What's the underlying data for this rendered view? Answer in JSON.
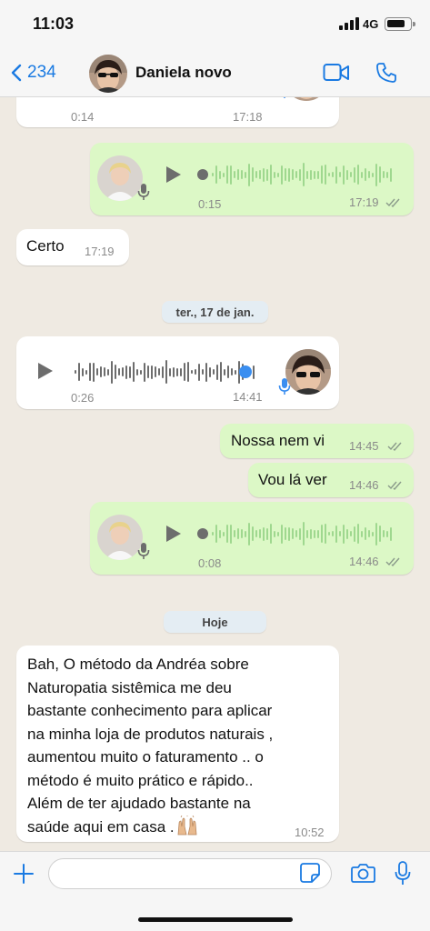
{
  "status_bar": {
    "time": "11:03",
    "network": "4G",
    "battery_level": 0.8
  },
  "header": {
    "back_count": "234",
    "contact_name": "Daniela novo",
    "icons": [
      "back-chevron-icon",
      "video-call-icon",
      "voice-call-icon"
    ]
  },
  "messages": [
    {
      "type": "voice",
      "direction": "incoming",
      "duration": "0:14",
      "time": "17:18",
      "partial": true
    },
    {
      "type": "voice",
      "direction": "outgoing",
      "duration": "0:15",
      "time": "17:19",
      "progress": 0.0
    },
    {
      "type": "text",
      "direction": "incoming",
      "text": "Certo",
      "time": "17:19"
    },
    {
      "type": "date",
      "label": "ter., 17 de jan."
    },
    {
      "type": "voice",
      "direction": "incoming",
      "duration": "0:26",
      "time": "14:41",
      "progress": 0.9
    },
    {
      "type": "text",
      "direction": "outgoing",
      "text": "Nossa nem vi",
      "time": "14:45"
    },
    {
      "type": "text",
      "direction": "outgoing",
      "text": "Vou lá ver",
      "time": "14:46"
    },
    {
      "type": "voice",
      "direction": "outgoing",
      "duration": "0:08",
      "time": "14:46",
      "progress": 0.0
    },
    {
      "type": "date",
      "label": "Hoje"
    },
    {
      "type": "text",
      "direction": "incoming",
      "time": "10:52",
      "lines": [
        "Bah, O método da Andréa  sobre",
        "Naturopatia sistêmica  me deu",
        "bastante conhecimento para aplicar",
        "na minha loja de produtos naturais ,",
        "aumentou muito o faturamento .. o",
        "método é muito prático e rápido..",
        "Além de ter ajudado bastante na",
        "saúde aqui em casa ."
      ],
      "emoji_icon": "raising-hands-emoji-icon"
    }
  ],
  "input_bar": {
    "placeholder": "",
    "icons": [
      "add-icon",
      "sticker-icon",
      "camera-icon",
      "microphone-icon"
    ]
  },
  "colors": {
    "accent": "#1a7ae2",
    "outgoing_bubble": "#dcf8c6",
    "incoming_bubble": "#ffffff",
    "chat_background": "#efeae2",
    "played_wave": "#3a8ef0",
    "incoming_wave": "#6d6d6d",
    "outgoing_wave": "#9fd88f"
  }
}
